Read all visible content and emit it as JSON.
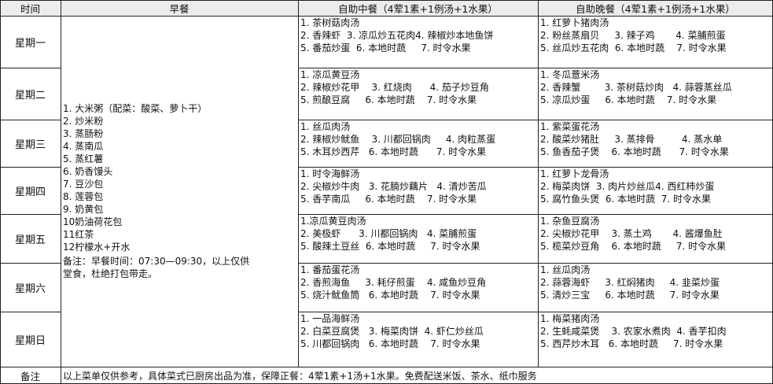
{
  "header": {
    "time": "时间",
    "breakfast": "早餐",
    "lunch": "自助中餐（4荤1素+1例汤+1水果）",
    "dinner": "自助晚餐（4荤1素+1例汤+1水果）"
  },
  "days": [
    {
      "name": "星期一",
      "lunch": [
        "1. 茶树菇肉汤",
        "2. 香辣虾  3. 凉瓜炒五花肉4. 辣椒炒本地鱼饼",
        "5. 番茄炒蛋  6. 本地时蔬     7. 时令水果"
      ],
      "dinner": [
        "1. 红萝卜猪肉汤",
        "2. 粉丝蒸扇贝     3. 辣子鸡       4. 菜脯煎蛋",
        "5. 丝瓜炒五花肉  6. 本地时蔬    7. 时令水果"
      ]
    },
    {
      "name": "星期二",
      "lunch": [
        "1. 凉瓜黄豆汤",
        "2. 辣椒炒花甲    3. 红烧肉      4. 茄子炒豆角",
        "5. 煎酿豆腐     6. 本地时蔬    7. 时令水果"
      ],
      "dinner": [
        "1. 冬瓜薏米汤",
        "2. 香辣蟹        3. 茶树菇炒肉   4. 蒜蓉蒸丝瓜",
        "5. 凉瓜炒蛋     6. 本地时蔬    7. 时令水果"
      ]
    },
    {
      "name": "星期三",
      "lunch": [
        "1. 丝瓜肉汤",
        "2. 辣椒炒鱿鱼    3. 川都回锅肉     4. 肉粒蒸蛋",
        "5. 木耳炒西芹   6. 本地时蔬      7. 时令水果"
      ],
      "dinner": [
        "1. 紫菜蛋花汤",
        "2. 酸菜炒猪肚     3. 蒸排骨         4. 蒸水单",
        "5. 鱼香茄子煲    6. 本地时蔬      7. 时令水果"
      ]
    },
    {
      "name": "星期四",
      "lunch": [
        "1. 时令海鲜汤",
        "2. 尖椒炒牛肉   3. 花腩炒藕片   4. 清炒苦瓜",
        "5. 香芋南瓜     6. 本地时蔬    7. 时令水果"
      ],
      "dinner": [
        "1. 红萝卜龙骨汤",
        "2. 梅菜肉饼  3. 肉片炒丝瓜4. 西红柿炒蛋",
        "5. 腐竹鱼头煲  6. 本地时蔬  7. 时令水果"
      ]
    },
    {
      "name": "星期五",
      "lunch": [
        "1.凉瓜黄豆肉汤",
        "2. 美极虾      3. 川都回锅肉   4. 菜脯煎蛋",
        "5. 酸辣土豆丝  6. 本地时蔬     7. 时令水果"
      ],
      "dinner": [
        "1. 杂鱼豆腐汤",
        "2. 尖椒炒花甲    3. 蒸土鸡       4. 酱爆鱼肚",
        "5. 榄菜炒豆角    6. 本地时蔬     7. 时令水果"
      ]
    },
    {
      "name": "星期六",
      "lunch": [
        "1. 番茄蛋花汤",
        "2. 香煎海鱼     3. 耗仔煎蛋    4. 咸鱼炒豆角",
        "5. 烧汁鱿鱼筒   6. 本地时蔬    7. 时令水果"
      ],
      "dinner": [
        "1. 丝瓜肉汤",
        "2. 蒜蓉海虾     3. 红焖猪肉     4. 韭菜炒蛋",
        "5. 清炒三宝     6. 本地时蔬     7. 时令水果"
      ]
    },
    {
      "name": "星期日",
      "lunch": [
        "1. 一品海鲜汤",
        "2. 白菜豆腐煲   3. 梅菜肉饼  4. 虾仁炒丝瓜",
        "5. 川都回锅肉   6. 本地时蔬    7. 时令水果"
      ],
      "dinner": [
        "1. 梅菜猪肉汤",
        "2. 生蚝咸菜煲    3. 农家水煮肉  4. 香芋扣肉",
        "5. 西芹炒木耳   6. 本地时蔬     7. 时令水果"
      ]
    }
  ],
  "breakfast_items": [
    "1. 大米粥（配菜：酸菜、萝卜干）",
    "2. 炒米粉",
    "3. 蒸肠粉",
    "4. 蒸南瓜",
    "5. 蒸红薯",
    "6. 奶香馒头",
    "7. 豆沙包",
    "8. 莲蓉包",
    "9. 奶黄包",
    "10奶油荷花包",
    "11红茶",
    "12柠檬水+开水"
  ],
  "breakfast_notes": [
    "备注：早餐时间：07:30—09:30，以上仅供",
    "堂食，杜绝打包带走。"
  ],
  "remark": {
    "label": "备注",
    "text": "以上菜单仅供参考，具体菜式已厨房出品为准，保障正餐：4荤1素+1汤+1水果。免费配送米饭、茶水、纸巾服务"
  }
}
